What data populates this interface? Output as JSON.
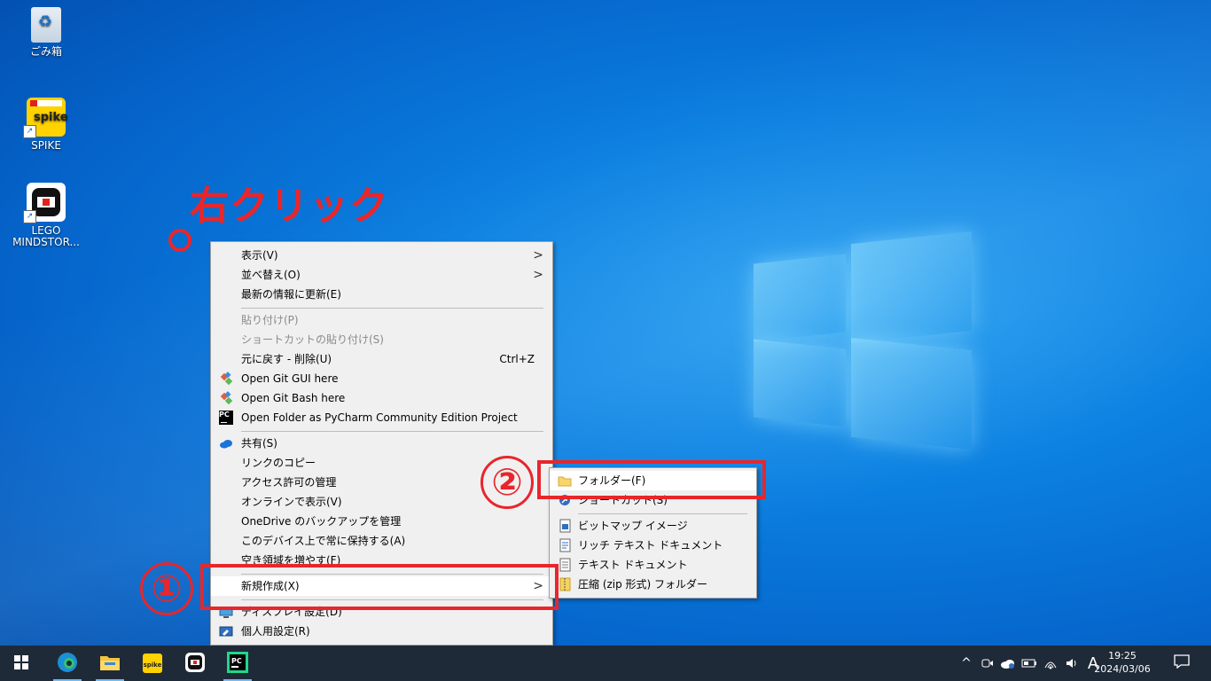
{
  "desktop": {
    "icons": [
      {
        "label": "ごみ箱"
      },
      {
        "label": "SPIKE"
      },
      {
        "label": "LEGO MINDSTOR..."
      }
    ]
  },
  "annotations": {
    "title": "右クリック",
    "num1": "①",
    "num2": "②",
    "color": "#e8262b"
  },
  "context_menu": {
    "items": [
      {
        "label": "表示(V)",
        "submenu": true
      },
      {
        "label": "並べ替え(O)",
        "submenu": true
      },
      {
        "label": "最新の情報に更新(E)"
      },
      {
        "label": "貼り付け(P)",
        "disabled": true
      },
      {
        "label": "ショートカットの貼り付け(S)",
        "disabled": true
      },
      {
        "label": "元に戻す - 削除(U)",
        "shortcut": "Ctrl+Z"
      },
      {
        "label": "Open Git GUI here",
        "icon": "git-icon"
      },
      {
        "label": "Open Git Bash here",
        "icon": "git-icon"
      },
      {
        "label": "Open Folder as PyCharm Community Edition Project",
        "icon": "pycharm-icon"
      },
      {
        "label": "共有(S)",
        "icon": "onedrive-icon"
      },
      {
        "label": "リンクのコピー"
      },
      {
        "label": "アクセス許可の管理"
      },
      {
        "label": "オンラインで表示(V)"
      },
      {
        "label": "OneDrive のバックアップを管理"
      },
      {
        "label": "このデバイス上で常に保持する(A)"
      },
      {
        "label": "空き領域を増やす(F)"
      },
      {
        "label": "新規作成(X)",
        "submenu": true
      },
      {
        "label": "ディスプレイ設定(D)",
        "icon": "display-icon"
      },
      {
        "label": "個人用設定(R)",
        "icon": "personalize-icon"
      }
    ]
  },
  "new_submenu": {
    "items": [
      {
        "label": "フォルダー(F)",
        "icon": "folder-icon"
      },
      {
        "label": "ショートカット(S)",
        "icon": "shortcut-icon"
      },
      {
        "label": "ビットマップ イメージ",
        "icon": "bitmap-icon"
      },
      {
        "label": "リッチ テキスト ドキュメント",
        "icon": "rtf-icon"
      },
      {
        "label": "テキスト ドキュメント",
        "icon": "text-doc-icon"
      },
      {
        "label": "圧縮 (zip 形式) フォルダー",
        "icon": "zip-folder-icon"
      }
    ]
  },
  "taskbar": {
    "apps": [
      "windows-start-icon",
      "edge-icon",
      "file-explorer-icon",
      "spike-icon",
      "mindstorms-icon",
      "pycharm-icon"
    ],
    "tray": {
      "chevron": "^",
      "ime": "A",
      "time": "19:25",
      "date": "2024/03/06"
    }
  }
}
